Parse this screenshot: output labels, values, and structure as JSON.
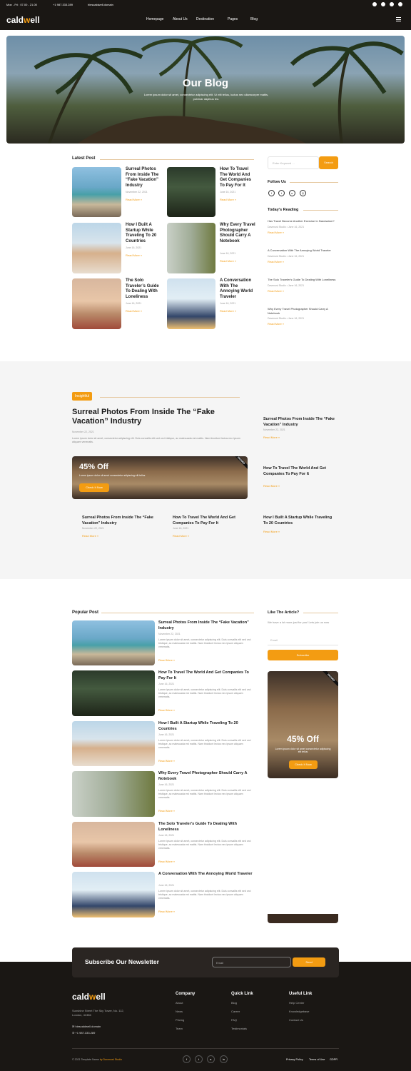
{
  "topbar": {
    "hours": "Mon - Fri : 07.00 - 21.00",
    "phone": "+1 987.333.289",
    "email": "hiescaldwell.domain"
  },
  "nav": {
    "logo_a": "cald",
    "logo_b": "w",
    "logo_c": "ell",
    "items": [
      "Homepage",
      "About Us",
      "Destination",
      "Pages",
      "Blog"
    ]
  },
  "hero": {
    "title": "Our Blog",
    "subtitle": "Lorem ipsum dolor sit amet, consectetur adipiscing elit. Ut elit tellus, luctus nec ullamcorper mattis, pulvinar dapibus leo."
  },
  "latest": {
    "title": "Latest Post",
    "read_more": "Read More »",
    "posts": [
      {
        "title": "Surreal Photos From Inside The “Fake Vacation” Industry",
        "date": "November 22, 2021"
      },
      {
        "title": "How To Travel The World And Get Companies To Pay For It",
        "date": "June 16, 2021"
      },
      {
        "title": "How I Built A Startup While Traveling To 20 Countries",
        "date": "June 16, 2021"
      },
      {
        "title": "Why Every Travel Photographer Should Carry A Notebook",
        "date": "June 16, 2021"
      },
      {
        "title": "The Solo Traveler’s Guide To Dealing With Loneliness",
        "date": "June 16, 2021"
      },
      {
        "title": "A Conversation With The Annoying World Traveler",
        "date": "June 16, 2021"
      }
    ]
  },
  "sidebar": {
    "search_placeholder": "Enter Keyword ...",
    "search_btn": "Search",
    "follow": "Follow Us",
    "today": "Today's Reading",
    "reading": [
      {
        "title": "Has Travel Become Another Exercise In Narcissism?",
        "meta": "Davenust Studio • June 16, 2021"
      },
      {
        "title": "A Conversation With The Annoying World Traveler",
        "meta": "Davenust Studio • June 16, 2021"
      },
      {
        "title": "The Solo Traveler's Guide To Dealing With Loneliness",
        "meta": "Davenust Studio • June 16, 2021"
      },
      {
        "title": "Why Every Travel Photographer Should Carry A Notebook",
        "meta": "Davenust Studio • June 16, 2021"
      }
    ],
    "read_more": "Read More »"
  },
  "featured": {
    "badge": "Insightful",
    "title": "Surreal Photos From Inside The “Fake Vacation” Industry",
    "date": "November 22, 2021",
    "excerpt": "Lorem ipsum dolor sit amet, consectetur adipiscing elit. Duis convallis elit sed orci tristique, ac malesuada est mattis. Nam tincidunt lectus nec ipsum aliquam venenatis.",
    "promo_title": "45% Off",
    "promo_text": "Lorem ipsum dolor sit amet consectetur adipiscing elit tellus",
    "promo_btn": "Check It Now",
    "promo_ribbon": "PROMO",
    "side": [
      {
        "title": "Surreal Photos From Inside The “Fake Vacation” Industry",
        "date": "November 22, 2021"
      },
      {
        "title": "How To Travel The World And Get Companies To Pay For It",
        "date": ""
      }
    ],
    "bottom": [
      {
        "title": "Surreal Photos From Inside The “Fake Vacation” Industry",
        "date": "November 22, 2021"
      },
      {
        "title": "How To Travel The World And Get Companies To Pay For It",
        "date": "June 16, 2021"
      },
      {
        "title": "How I Built A Startup While Traveling To 20 Countries",
        "date": ""
      }
    ],
    "read_more": "Read More »"
  },
  "popular": {
    "title": "Popular Post",
    "read_more": "Read More »",
    "excerpt": "Lorem ipsum dolor sit amet, consectetur adipiscing elit. Duis convallis elit sed orci tristique, ac malesuada est mattis. Nam tincidunt lectus nec ipsum aliquam venenatis.",
    "posts": [
      {
        "title": "Surreal Photos From Inside The “Fake Vacation” Industry",
        "date": "November 22, 2021"
      },
      {
        "title": "How To Travel The World And Get Companies To Pay For It",
        "date": "June 16, 2021"
      },
      {
        "title": "How I Built A Startup While Traveling To 20 Countries",
        "date": "June 16, 2021"
      },
      {
        "title": "Why Every Travel Photographer Should Carry A Notebook",
        "date": "June 16, 2021"
      },
      {
        "title": "The Solo Traveler's Guide To Dealing With Loneliness",
        "date": "June 16, 2021"
      },
      {
        "title": "A Conversation With The Annoying World Traveler",
        "date": "June 16, 2021"
      }
    ]
  },
  "like": {
    "title": "Like The Article?",
    "text": "We have a lot more just for you! Lets join us now",
    "placeholder": "Email",
    "btn": "Subscribe",
    "promo_title": "45% Off",
    "promo_text": "Lorem ipsum dolor sit amet consectetur adipiscing elit tellus",
    "promo_btn": "Check It Now",
    "promo_ribbon": "PROMO"
  },
  "newsletter": {
    "title": "Subscribe Our Newsletter",
    "placeholder": "Email",
    "btn": "Send"
  },
  "footer": {
    "address": "Sunshine Street The Sky Tower, No. 112, London, 41386",
    "email": "hiescaldwell.domain",
    "phone": "+1 987.333.289",
    "company": {
      "title": "Company",
      "items": [
        "About",
        "News",
        "Pricing",
        "Team"
      ]
    },
    "quick": {
      "title": "Quick Link",
      "items": [
        "Blog",
        "Career",
        "FAQ",
        "Testimonials"
      ]
    },
    "useful": {
      "title": "Useful Link",
      "items": [
        "Help Center",
        "Knowledgebase",
        "Contact Us"
      ]
    },
    "copyright": "© 2021 Template Name",
    "by": "by Davenust Studio",
    "legal": [
      "Privacy Policy",
      "Terms of Use",
      "GDPR"
    ]
  }
}
